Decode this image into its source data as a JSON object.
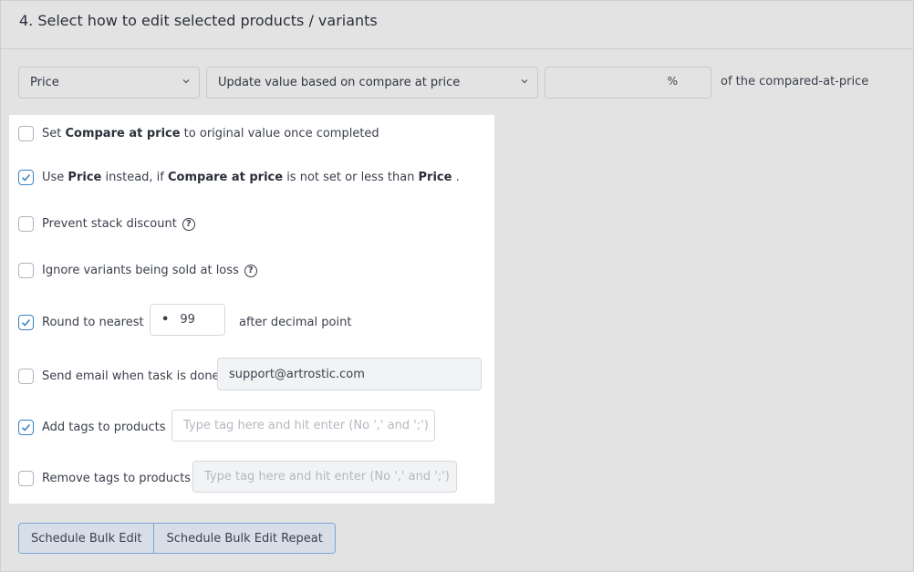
{
  "section": {
    "title": "4. Select how to edit selected products / variants"
  },
  "controls": {
    "field_select": "Price",
    "mode_select": "Update value based on compare at price",
    "percent_value": "",
    "percent_unit": "%",
    "suffix": "of the compared-at-price"
  },
  "options": {
    "set_compare": {
      "checked": false,
      "pre": "Set ",
      "bold": "Compare at price",
      "post": " to original value once completed"
    },
    "use_price": {
      "checked": true,
      "t1": "Use ",
      "b1": "Price",
      "t2": " instead, if ",
      "b2": "Compare at price",
      "t3": " is not set or less than ",
      "b3": "Price",
      "t4": " ."
    },
    "prevent_stack": {
      "checked": false,
      "label": "Prevent stack discount",
      "help": "?"
    },
    "ignore_loss": {
      "checked": false,
      "label": "Ignore variants being sold at loss",
      "help": "?"
    },
    "round": {
      "checked": true,
      "label": "Round to nearest",
      "dot": "•",
      "value": "99",
      "after": "after decimal point"
    },
    "send_email": {
      "checked": false,
      "label": "Send email when task is done",
      "email": "support@artrostic.com"
    },
    "add_tags": {
      "checked": true,
      "label": "Add tags to products",
      "placeholder": "Type tag here and hit enter (No ',' and ';')"
    },
    "remove_tags": {
      "checked": false,
      "label": "Remove tags to products",
      "placeholder": "Type tag here and hit enter (No ',' and ';')"
    }
  },
  "buttons": {
    "schedule": "Schedule Bulk Edit",
    "schedule_repeat": "Schedule Bulk Edit Repeat"
  },
  "colors": {
    "accent": "#3b82c4",
    "panel_bg": "#ffffff",
    "page_bg": "#e3e3e3"
  }
}
